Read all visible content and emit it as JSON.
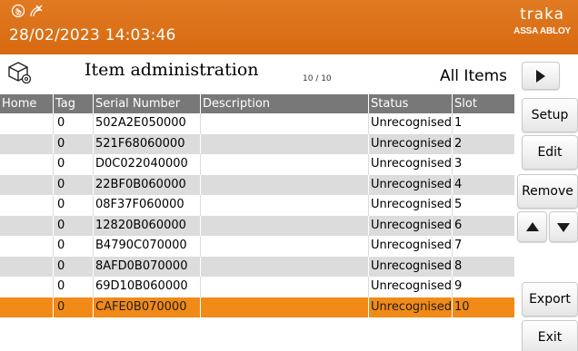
{
  "colors": {
    "header_bg": "#d86a10",
    "selected_row": "#f28a17",
    "table_header_bg": "#787878",
    "alt_row": "#dcdcdc"
  },
  "header": {
    "status_icons": [
      "hand-tap-icon",
      "no-signal-icon"
    ],
    "datetime": "28/02/2023 14:03:46",
    "brand_top": "traka",
    "brand_bottom": "ASSA ABLOY"
  },
  "title_row": {
    "icon": "box-settings-icon",
    "title": "Item administration",
    "count": "10 / 10",
    "filter": "All Items"
  },
  "table": {
    "columns": [
      "Home",
      "Tag",
      "Serial Number",
      "Description",
      "Status",
      "Slot"
    ],
    "rows": [
      {
        "home": "",
        "tag": "0",
        "serial": "502A2E050000",
        "description": "",
        "status": "Unrecognised",
        "slot": "1"
      },
      {
        "home": "",
        "tag": "0",
        "serial": "521F68060000",
        "description": "",
        "status": "Unrecognised",
        "slot": "2"
      },
      {
        "home": "",
        "tag": "0",
        "serial": "D0C022040000",
        "description": "",
        "status": "Unrecognised",
        "slot": "3"
      },
      {
        "home": "",
        "tag": "0",
        "serial": "22BF0B060000",
        "description": "",
        "status": "Unrecognised",
        "slot": "4"
      },
      {
        "home": "",
        "tag": "0",
        "serial": "08F37F060000",
        "description": "",
        "status": "Unrecognised",
        "slot": "5"
      },
      {
        "home": "",
        "tag": "0",
        "serial": "12820B060000",
        "description": "",
        "status": "Unrecognised",
        "slot": "6"
      },
      {
        "home": "",
        "tag": "0",
        "serial": "B4790C070000",
        "description": "",
        "status": "Unrecognised",
        "slot": "7"
      },
      {
        "home": "",
        "tag": "0",
        "serial": "8AFD0B070000",
        "description": "",
        "status": "Unrecognised",
        "slot": "8"
      },
      {
        "home": "",
        "tag": "0",
        "serial": "69D10B060000",
        "description": "",
        "status": "Unrecognised",
        "slot": "9"
      },
      {
        "home": "",
        "tag": "0",
        "serial": "CAFE0B070000",
        "description": "",
        "status": "Unrecognised",
        "slot": "10",
        "selected": true
      }
    ]
  },
  "buttons": {
    "play_icon": "play-icon",
    "setup": "Setup",
    "edit": "Edit",
    "remove": "Remove",
    "up_icon": "arrow-up-icon",
    "down_icon": "arrow-down-icon",
    "export": "Export",
    "exit": "Exit"
  }
}
